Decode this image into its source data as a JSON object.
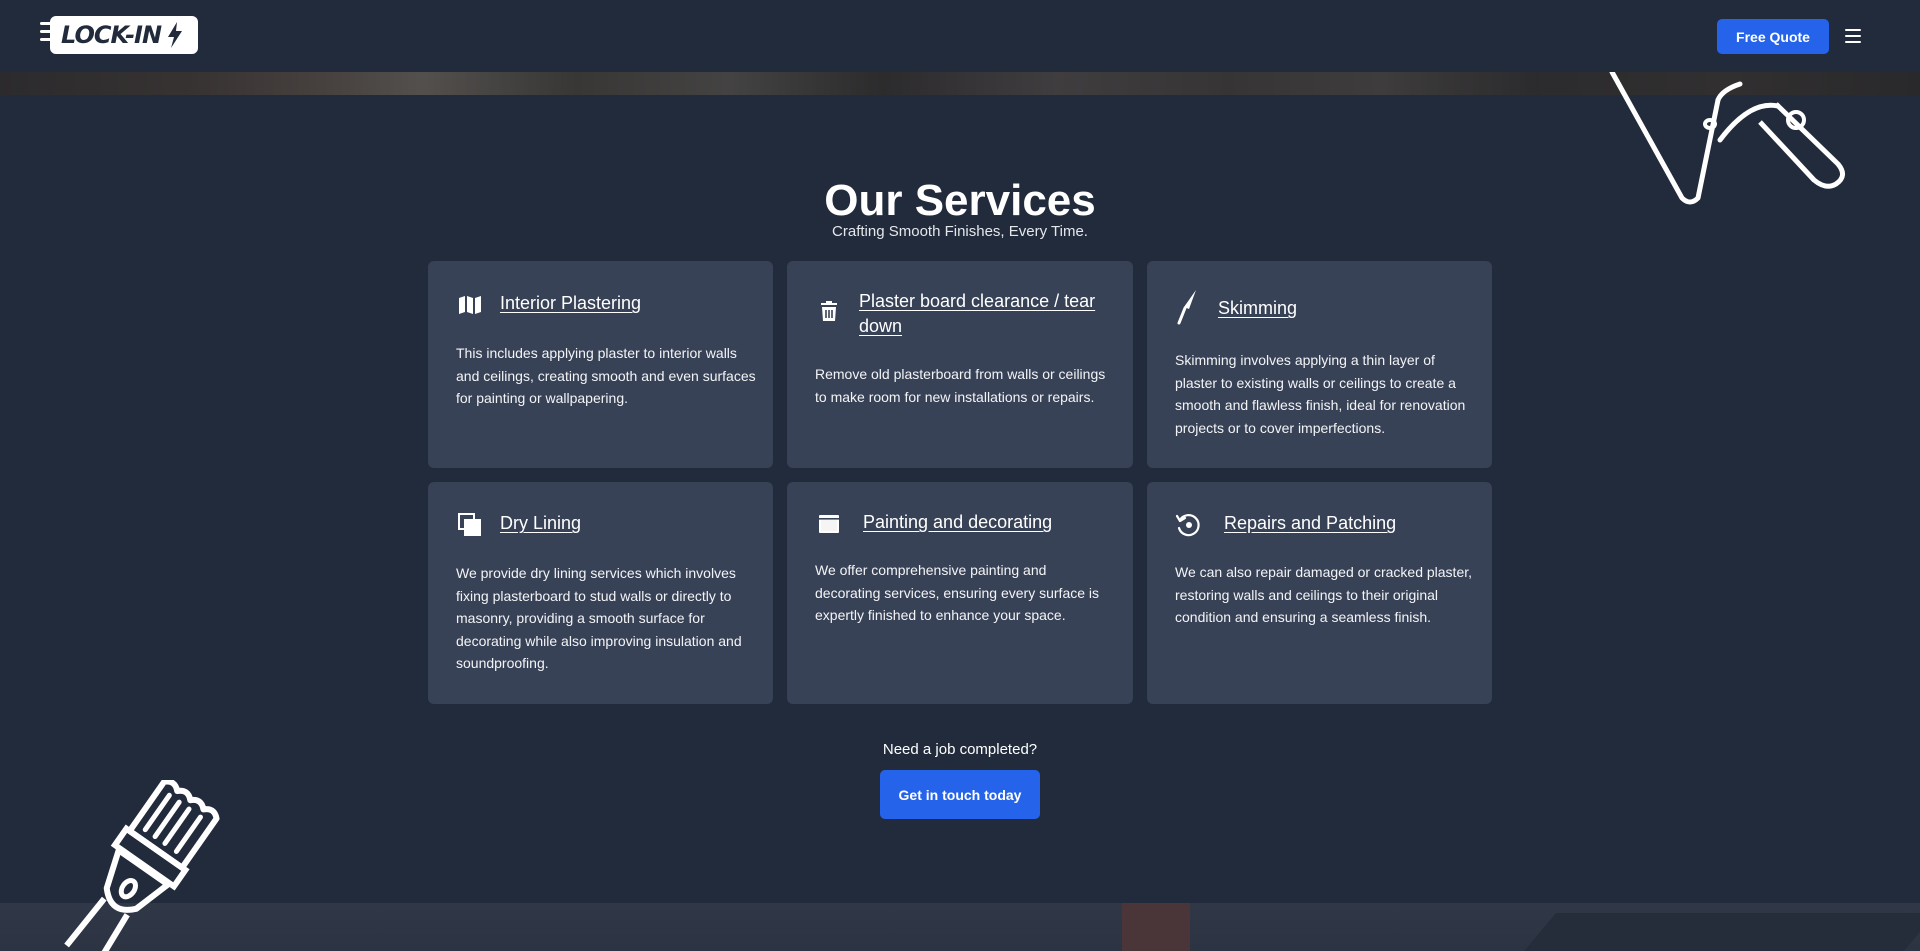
{
  "header": {
    "logo_text": "LOCK-IN",
    "quote_label": "Free Quote"
  },
  "section": {
    "title": "Our Services",
    "subtitle": "Crafting Smooth Finishes, Every Time."
  },
  "services": [
    {
      "icon": "map-icon",
      "title": "Interior Plastering",
      "description": "This includes applying plaster to interior walls and ceilings, creating smooth and even surfaces for painting or wallpapering."
    },
    {
      "icon": "trash-icon",
      "title_line1": "Plaster board clearance / tear",
      "title_line2": "down",
      "description": "Remove old plasterboard from walls or ceilings to make room for new installations or repairs."
    },
    {
      "icon": "trowel-icon",
      "title": "Skimming",
      "description": "Skimming involves applying a thin layer of plaster to existing walls or ceilings to create a smooth and flawless finish, ideal for renovation projects or to cover imperfections."
    },
    {
      "icon": "copy-icon",
      "title": "Dry Lining",
      "description": "We provide dry lining services which involves fixing plasterboard to stud walls or directly to masonry, providing a smooth surface for decorating while also improving insulation and soundproofing."
    },
    {
      "icon": "window-icon",
      "title": "Painting and decorating",
      "description": "We offer comprehensive painting and decorating services, ensuring every surface is expertly finished to enhance your space."
    },
    {
      "icon": "repair-icon",
      "title": "Repairs and Patching",
      "description": "We can also repair damaged or cracked plaster, restoring walls and ceilings to their original condition and ensuring a seamless finish."
    }
  ],
  "cta": {
    "prompt": "Need a job completed?",
    "button_label": "Get in touch today"
  },
  "colors": {
    "background": "#222b3b",
    "card": "#384256",
    "accent": "#2563eb"
  }
}
